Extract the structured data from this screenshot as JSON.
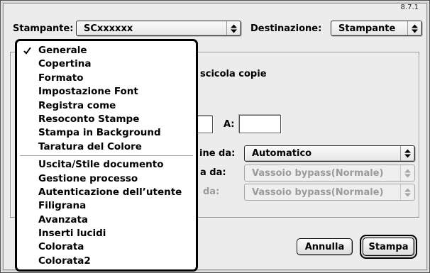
{
  "window": {
    "version": "8.7.1"
  },
  "printer": {
    "label": "Stampante:",
    "value": "SCxxxxxx"
  },
  "destination": {
    "label": "Destinazione:",
    "value": "Stampante"
  },
  "panel_menu": {
    "open": true,
    "groups": [
      {
        "items": [
          {
            "label": "Generale",
            "checked": true
          },
          {
            "label": "Copertina",
            "checked": false
          },
          {
            "label": "Formato",
            "checked": false
          },
          {
            "label": "Impostazione Font",
            "checked": false
          },
          {
            "label": "Registra come",
            "checked": false
          },
          {
            "label": "Resoconto Stampe",
            "checked": false
          },
          {
            "label": "Stampa in Background",
            "checked": false
          },
          {
            "label": "Taratura del Colore",
            "checked": false
          }
        ]
      },
      {
        "items": [
          {
            "label": "Uscita/Stile documento",
            "checked": false
          },
          {
            "label": "Gestione processo",
            "checked": false
          },
          {
            "label": "Autenticazione dell’utente",
            "checked": false
          },
          {
            "label": "Filigrana",
            "checked": false
          },
          {
            "label": "Avanzata",
            "checked": false
          },
          {
            "label": "Inserti lucidi",
            "checked": false
          },
          {
            "label": "Colorata",
            "checked": false
          },
          {
            "label": "Colorata2",
            "checked": false
          }
        ]
      }
    ]
  },
  "general_panel": {
    "collate_label": "scicola copie",
    "pages_from_value": "",
    "pages_to_label": "A:",
    "pages_to_value": "",
    "paper_source": {
      "label": "ine da:",
      "value": "Automatico",
      "enabled": true
    },
    "first_page_source": {
      "label": "a da:",
      "value": "Vassoio bypass(Normale)",
      "enabled": false
    },
    "remaining_source": {
      "label": "da:",
      "value": "Vassoio bypass(Normale)",
      "enabled": false
    }
  },
  "buttons": {
    "cancel": "Annulla",
    "print": "Stampa",
    "print_is_default": true
  },
  "icons": {
    "menu_check": "checkmark-icon",
    "popup_arrows": "up-down-arrows-icon"
  },
  "colors": {
    "window_bg": "#ececec",
    "menu_bg": "#ffffff",
    "menu_border": "#000000",
    "text": "#000000",
    "disabled_text": "#9b9b9b"
  }
}
